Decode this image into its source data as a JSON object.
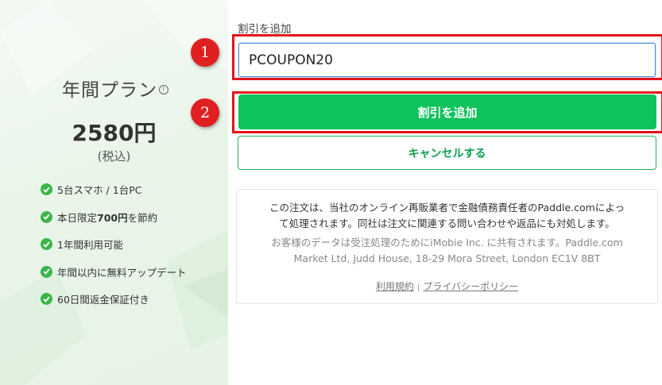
{
  "plan": {
    "title": "年間プラン",
    "price": "2580円",
    "tax_note": "(税込)",
    "info_icon_glyph": "!"
  },
  "features": [
    {
      "text": "5台スマホ / 1台PC"
    },
    {
      "prefix": "本日限定",
      "bold": "700円",
      "suffix": "を節約"
    },
    {
      "text": "1年間利用可能"
    },
    {
      "text": "年間以内に無料アップデート"
    },
    {
      "text": "60日間返金保証付き"
    }
  ],
  "coupon": {
    "label": "割引を追加",
    "value": "PCOUPON20",
    "apply_label": "割引を追加",
    "cancel_label": "キャンセルする"
  },
  "notice": {
    "line1a": "この注文は、当社のオンライン再販業者で金融債務責任者のPaddle.comによっ",
    "line1b": "て処理されます。同社は注文に関連する問い合わせや返品にも対処します。",
    "line2a": "お客様のデータは受注処理のためにiMobie Inc. に共有されます。Paddle.com",
    "line2b": "Market Ltd, Judd House, 18-29 Mora Street, London EC1V 8BT",
    "terms_link": "利用規約",
    "separator": "|",
    "privacy_link": "プライバシーポリシー"
  },
  "badges": {
    "first": "1",
    "second": "2"
  },
  "colors": {
    "accent_green": "#0ec25c",
    "check_green": "#3cb54a",
    "highlight_red": "#e3141b",
    "badge_red": "#e02020"
  }
}
